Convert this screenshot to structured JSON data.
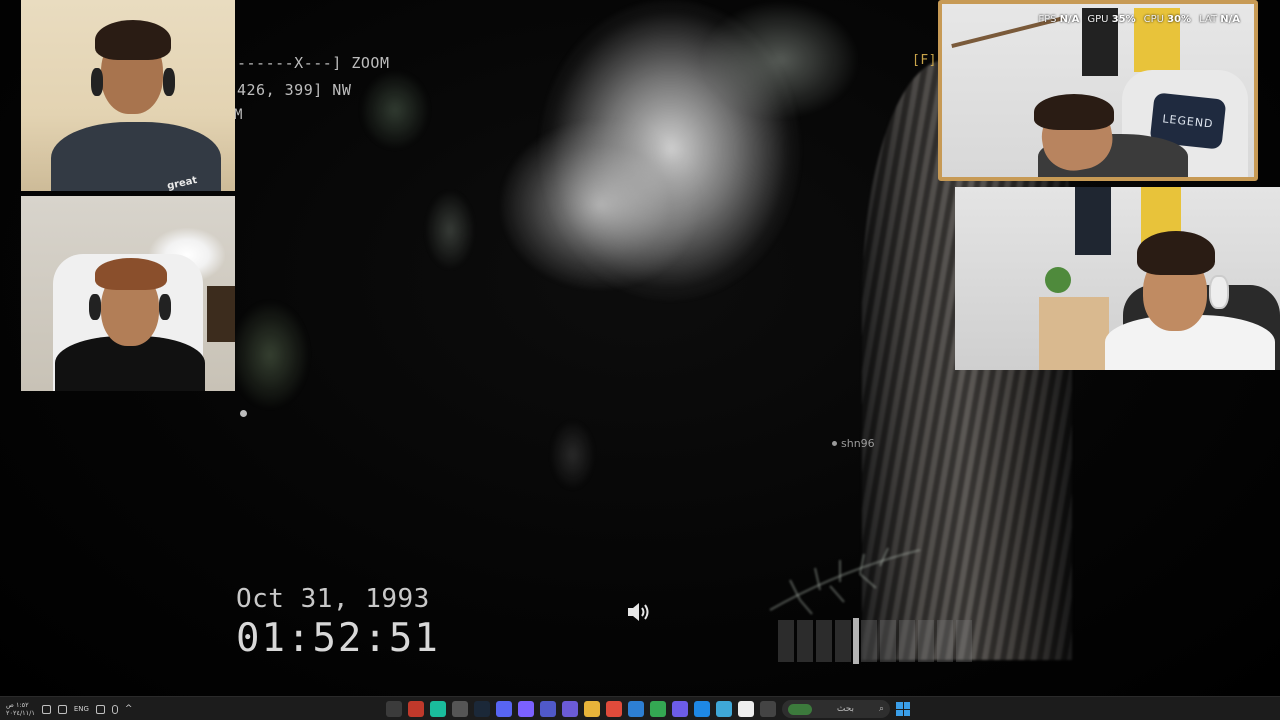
{
  "game": {
    "hud": {
      "zoom_indicator": "------X---] ZOOM",
      "coords": "426, 399] NW",
      "mode": "M",
      "key_hint": "[F]",
      "date": "Oct 31, 1993",
      "time": "01:52:51",
      "player_name": "shn96",
      "audio_level": 0.38
    }
  },
  "webcams": {
    "cam1": {
      "shirt_text": "great"
    },
    "cam3": {
      "stats": [
        {
          "label": "FPS",
          "value": "N/A"
        },
        {
          "label": "GPU",
          "value": "35%"
        },
        {
          "label": "CPU",
          "value": "30%"
        },
        {
          "label": "LAT",
          "value": "N/A"
        }
      ],
      "pillow_text": "LEGEND"
    }
  },
  "taskbar": {
    "clock_time": "١:٥٢ ص",
    "clock_date": "٢٠٢٤/١١/١",
    "language": "ENG",
    "search_placeholder": "بحث",
    "apps": [
      "media-player",
      "chrome-red",
      "app-green",
      "settings",
      "steam",
      "discord",
      "messenger",
      "teams",
      "chat",
      "file-explorer",
      "adobe",
      "app-blue",
      "chrome",
      "maps",
      "edge",
      "photos",
      "calendar",
      "window"
    ],
    "colors": {
      "accent": "#3a9ee8",
      "frame": "#c79a55"
    }
  }
}
